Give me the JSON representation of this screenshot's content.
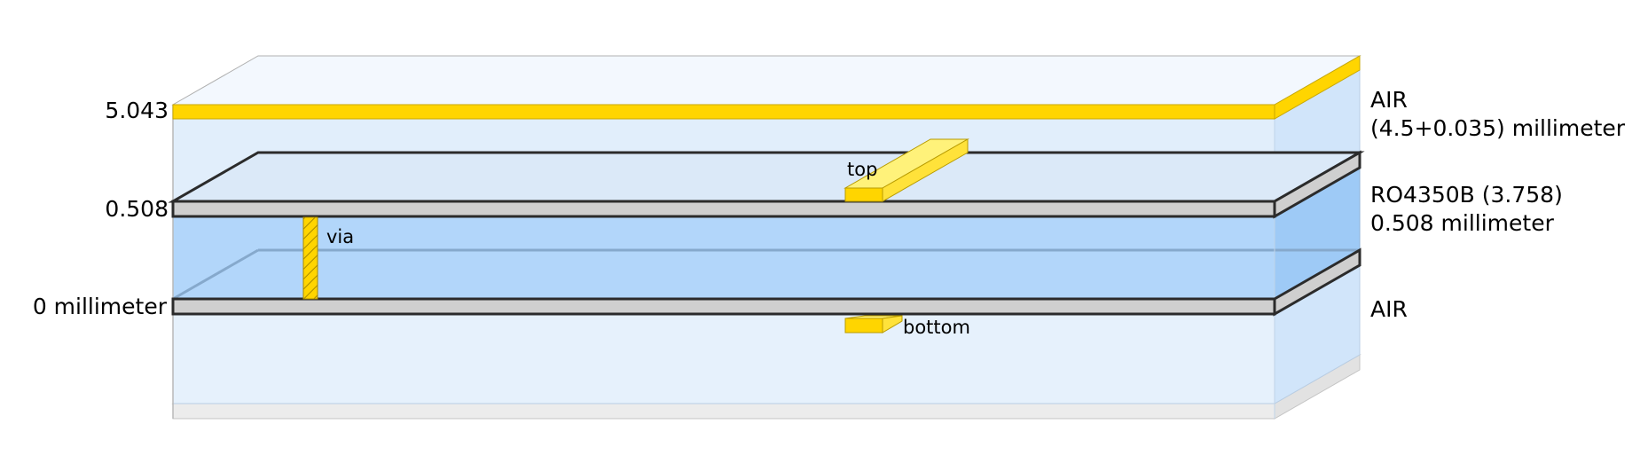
{
  "diagram": {
    "height_labels": {
      "top_plane": "5.043",
      "substrate_top": "0.508",
      "substrate_bottom": "0 millimeter"
    },
    "layer_labels": {
      "air_top_name": "AIR",
      "air_top_thickness": "(4.5+0.035) millimeter",
      "substrate_name": "RO4350B (3.758)",
      "substrate_thickness": "0.508 millimeter",
      "air_bottom_name": "AIR"
    },
    "component_labels": {
      "via": "via",
      "top": "top",
      "bottom": "bottom"
    },
    "colors": {
      "air": "#d6e8fb",
      "substrate": "#a9d0f7",
      "metal": "#ffd500",
      "metal_light": "#fff27a",
      "plate": "#cfcfcf",
      "outline": "#2b2b2b"
    }
  }
}
